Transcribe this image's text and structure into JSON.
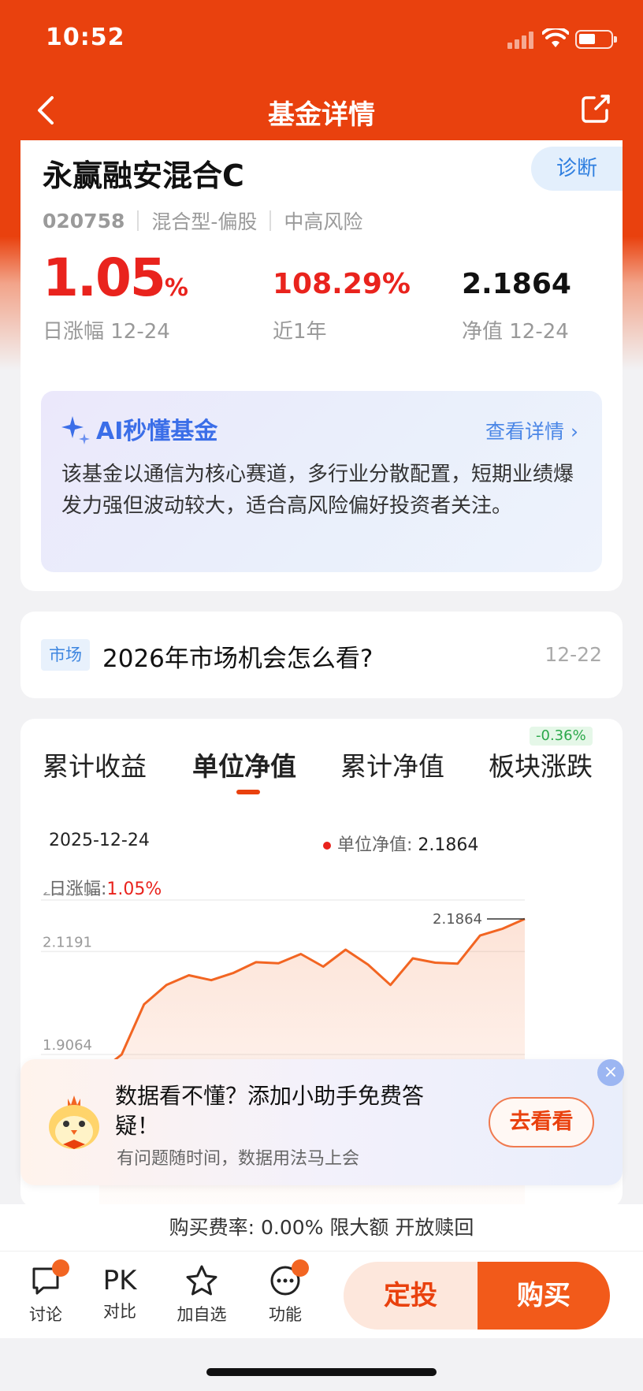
{
  "status": {
    "time": "10:52"
  },
  "nav": {
    "title": "基金详情"
  },
  "fund": {
    "name": "永赢融安混合C",
    "diagnose_label": "诊断",
    "code": "020758",
    "type": "混合型-偏股",
    "risk": "中高风险",
    "daily_change": "1.05",
    "daily_change_unit": "%",
    "daily_change_label": "日涨幅 12-24",
    "year_return": "108.29%",
    "year_return_label": "近1年",
    "nav_value": "2.1864",
    "nav_label": "净值 12-24"
  },
  "ai": {
    "title": "AI秒懂基金",
    "more": "查看详情 ›",
    "text": "该基金以通信为核心赛道，多行业分散配置，短期业绩爆发力强但波动较大，适合高风险偏好投资者关注。"
  },
  "news": {
    "tag": "市场",
    "title": "2026年市场机会怎么看?",
    "date": "12-22"
  },
  "chart_tabs": {
    "tabs": [
      "累计收益",
      "单位净值",
      "累计净值",
      "板块涨跌"
    ],
    "active_index": 1,
    "sector_badge": "-0.36%"
  },
  "chart_info": {
    "date": "2025-12-24",
    "legend_label": "单位净值: ",
    "legend_value": "2.1864",
    "change_label": "日涨幅:",
    "change_value": "1.05%"
  },
  "chart_data": {
    "type": "area",
    "title": "",
    "series": [
      {
        "name": "单位净值",
        "values": [
          1.87,
          1.9064,
          2.01,
          2.05,
          2.07,
          2.06,
          2.075,
          2.097,
          2.095,
          2.114,
          2.088,
          2.123,
          2.092,
          2.05,
          2.105,
          2.096,
          2.094,
          2.152,
          2.166,
          2.1864
        ]
      }
    ],
    "y_ticks": [
      "2.2255",
      "2.1191",
      "1.9064"
    ],
    "ylim": [
      1.9064,
      2.2255
    ],
    "last_label": "2.1864",
    "color": "#f26522"
  },
  "promo": {
    "title": "数据看不懂？添加小助手免费答疑！",
    "subtitle": "有问题随时间，数据用法马上会",
    "button": "去看看",
    "close": "×"
  },
  "fee": {
    "text": "购买费率: 0.00% 限大额 开放赎回"
  },
  "bottom": {
    "discuss": "讨论",
    "pk_icon": "PK",
    "compare": "对比",
    "watch": "加自选",
    "features": "功能",
    "sip": "定投",
    "buy": "购买"
  },
  "colors": {
    "brand": "#e9410e",
    "up": "#e9231d",
    "down": "#2ba84a",
    "link": "#3b6ee8"
  }
}
